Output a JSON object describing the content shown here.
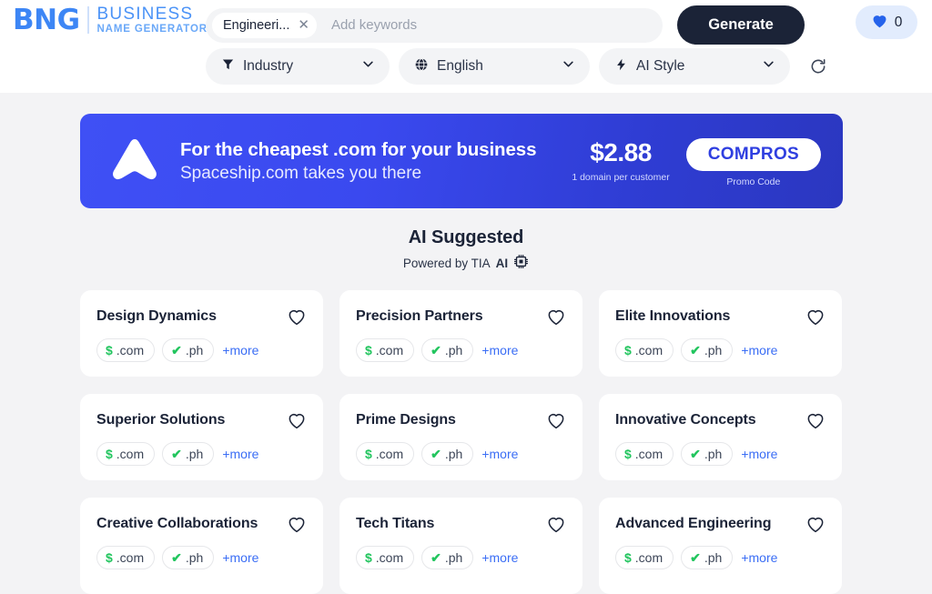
{
  "header": {
    "logo": {
      "mark": "BNG",
      "line1": "BUSINESS",
      "line2": "NAME GENERATOR"
    },
    "search": {
      "keyword_chip": "Engineeri...",
      "remove_icon": "close-icon",
      "placeholder": "Add keywords"
    },
    "generate_label": "Generate",
    "favorites": {
      "icon": "heart-filled-icon",
      "count": "0"
    },
    "filters": [
      {
        "icon": "funnel-icon",
        "label": "Industry",
        "chevron": "chevron-down-icon"
      },
      {
        "icon": "globe-icon",
        "label": "English",
        "chevron": "chevron-down-icon"
      },
      {
        "icon": "lightning-icon",
        "label": "AI Style",
        "chevron": "chevron-down-icon"
      }
    ],
    "refresh_icon": "refresh-icon"
  },
  "banner": {
    "logo_icon": "spaceship-icon",
    "title": "For the cheapest .com for your business",
    "subtitle": "Spaceship.com takes you there",
    "price": "$2.88",
    "price_note": "1 domain per customer",
    "promo_code": "COMPROS",
    "promo_note": "Promo Code",
    "accent_from": "#3f50f5",
    "accent_to": "#2b37c0"
  },
  "section": {
    "title": "AI Suggested",
    "powered_prefix": "Powered by TIA",
    "powered_ai": "AI",
    "powered_icon": "chip-icon"
  },
  "results": {
    "chip_com": {
      "symbol": "$",
      "tld": ".com"
    },
    "chip_ph": {
      "symbol": "✔",
      "tld": ".ph"
    },
    "more_label": "+more",
    "favorite_icon": "heart-outline-icon",
    "cards": [
      {
        "name": "Design Dynamics",
        "tall": false
      },
      {
        "name": "Precision Partners",
        "tall": false
      },
      {
        "name": "Elite Innovations",
        "tall": false
      },
      {
        "name": "Superior Solutions",
        "tall": false
      },
      {
        "name": "Prime Designs",
        "tall": false
      },
      {
        "name": "Innovative Concepts",
        "tall": false
      },
      {
        "name": "Creative Collaborations",
        "tall": true
      },
      {
        "name": "Tech Titans",
        "tall": false
      },
      {
        "name": "Advanced Engineering",
        "tall": true
      }
    ]
  },
  "colors": {
    "brand_blue": "#3d86f5",
    "dark": "#1b2337",
    "page_bg": "#f3f3f5",
    "available_green": "#22c55e",
    "link_blue": "#3b6ef5"
  }
}
